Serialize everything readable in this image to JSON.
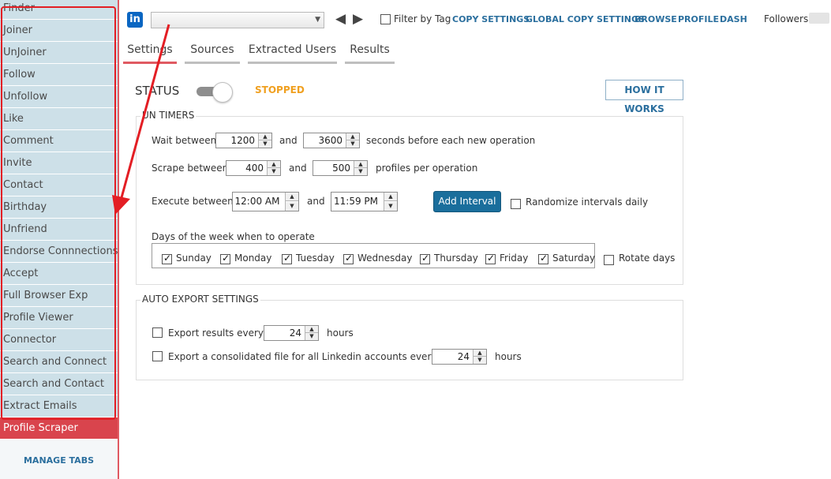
{
  "sidebar": {
    "items": [
      {
        "label": "Finder"
      },
      {
        "label": "Joiner"
      },
      {
        "label": "UnJoiner"
      },
      {
        "label": "Follow"
      },
      {
        "label": "Unfollow"
      },
      {
        "label": "Like"
      },
      {
        "label": "Comment"
      },
      {
        "label": "Invite"
      },
      {
        "label": "Contact"
      },
      {
        "label": "Birthday"
      },
      {
        "label": "Unfriend"
      },
      {
        "label": "Endorse Connnections"
      },
      {
        "label": "Accept"
      },
      {
        "label": "Full Browser Exp"
      },
      {
        "label": "Profile Viewer"
      },
      {
        "label": "Connector"
      },
      {
        "label": "Search and Connect"
      },
      {
        "label": "Search and Contact"
      },
      {
        "label": "Extract Emails"
      },
      {
        "label": "Profile Scraper"
      }
    ],
    "active_index": 19,
    "manage_tabs": "MANAGE TABS"
  },
  "topbar": {
    "logo": "in",
    "account_value": "",
    "filter_label": "Filter by Tag",
    "links": [
      "COPY SETTINGS",
      "GLOBAL COPY SETTINGS",
      "BROWSE",
      "PROFILE",
      "DASH"
    ],
    "followers_label": "Followers:"
  },
  "tabs": [
    {
      "label": "Settings",
      "active": true
    },
    {
      "label": "Sources",
      "active": false
    },
    {
      "label": "Extracted Users",
      "active": false
    },
    {
      "label": "Results",
      "active": false
    }
  ],
  "status": {
    "label": "STATUS",
    "value": "STOPPED",
    "toggle_on": false,
    "how_it_works": "HOW IT WORKS"
  },
  "run_timers": {
    "title": "UN TIMERS",
    "wait_label": "Wait between",
    "wait_min": "1200",
    "wait_and": "and",
    "wait_max": "3600",
    "wait_suffix": "seconds before each new operation",
    "scrape_label": "Scrape between",
    "scrape_min": "400",
    "scrape_and": "and",
    "scrape_max": "500",
    "scrape_suffix": "profiles per operation",
    "execute_label": "Execute between",
    "execute_start": "12:00 AM",
    "execute_and": "and",
    "execute_end": "11:59 PM",
    "add_interval": "Add Interval",
    "randomize_label": "Randomize intervals daily",
    "randomize_checked": false,
    "days_label": "Days of the week when to operate",
    "days": [
      {
        "label": "Sunday",
        "checked": true
      },
      {
        "label": "Monday",
        "checked": true
      },
      {
        "label": "Tuesday",
        "checked": true
      },
      {
        "label": "Wednesday",
        "checked": true
      },
      {
        "label": "Thursday",
        "checked": true
      },
      {
        "label": "Friday",
        "checked": true
      },
      {
        "label": "Saturday",
        "checked": true
      }
    ],
    "rotate_label": "Rotate days",
    "rotate_checked": false
  },
  "auto_export": {
    "title": "AUTO EXPORT SETTINGS",
    "export_every_label": "Export results every",
    "export_every_value": "24",
    "export_every_unit": "hours",
    "export_every_checked": false,
    "consolidated_label": "Export a consolidated file for all Linkedin accounts every",
    "consolidated_value": "24",
    "consolidated_unit": "hours",
    "consolidated_checked": false
  },
  "colors": {
    "accent_red": "#d9444d",
    "link_blue": "#2b6f9e",
    "status_orange": "#f0a020",
    "button_blue": "#1a6e9c",
    "sidebar_bg": "#cde0e8"
  }
}
